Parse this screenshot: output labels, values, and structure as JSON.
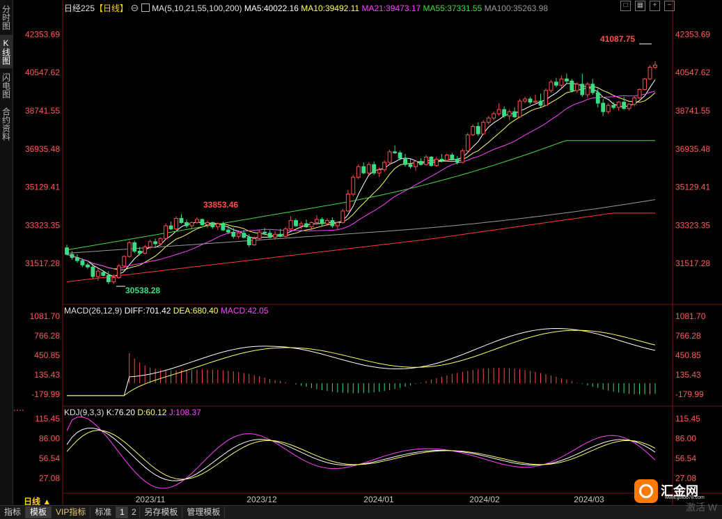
{
  "side_tabs": [
    {
      "label": "分时图",
      "active": false
    },
    {
      "label": "K线图",
      "active": true
    },
    {
      "label": "闪电图",
      "active": false
    },
    {
      "label": "合约资料",
      "active": false
    }
  ],
  "legend_main": {
    "symbol": "日经225",
    "period": "【日线】",
    "ma_params": "MA(5,10,21,55,100,200)",
    "ma5": "MA5:40022.16",
    "ma10": "MA10:39492.11",
    "ma21": "MA21:39473.17",
    "ma55": "MA55:37331.55",
    "ma100": "MA100:35263.98"
  },
  "legend_macd": {
    "name": "MACD(26,12,9)",
    "diff": "DIFF:701.42",
    "dea": "DEA:680.40",
    "macd": "MACD:42.05"
  },
  "legend_kdj": {
    "name": "KDJ(9,3,3)",
    "k": "K:76.20",
    "d": "D:60.12",
    "j": "J:108.37"
  },
  "price_axis": [
    "42353.69",
    "40547.62",
    "38741.55",
    "36935.48",
    "35129.41",
    "33323.35",
    "31517.28"
  ],
  "macd_axis": [
    "1081.70",
    "766.28",
    "450.85",
    "135.43",
    "-179.99"
  ],
  "kdj_axis": [
    "115.45",
    "86.00",
    "56.54",
    "27.08"
  ],
  "x_axis": [
    "2023/11",
    "2023/12",
    "2024/01",
    "2024/02",
    "2024/03"
  ],
  "annotations": {
    "high_label": "41087.75",
    "mid_high_label": "33853.46",
    "low_label": "30538.28"
  },
  "bottom_tabs": [
    "指标",
    "模板",
    "VIP指标",
    "标准",
    "1",
    "2",
    "另存模板",
    "管理模板"
  ],
  "period_label": "日线 ▲",
  "watermark": {
    "name": "汇金网",
    "url": "www.gold678.com"
  },
  "activate_text": "激活 W",
  "colors": {
    "up": "#ff4f4f",
    "down": "#3ddc84",
    "ma5": "#ffffff",
    "ma10": "#ffff66",
    "ma21": "#ff44ff",
    "ma55": "#44dd44",
    "ma100": "#9a9a9a",
    "ma200": "#ff3b3b",
    "axis_text": "#ff5b5b"
  },
  "chart_data": {
    "type": "candlestick",
    "price_range": [
      29711,
      43257
    ],
    "candles": [
      {
        "o": 32258,
        "h": 32400,
        "l": 31900,
        "c": 31950
      },
      {
        "o": 31950,
        "h": 32100,
        "l": 31700,
        "c": 31800
      },
      {
        "o": 31800,
        "h": 31950,
        "l": 31550,
        "c": 31650
      },
      {
        "o": 31650,
        "h": 31750,
        "l": 31350,
        "c": 31450
      },
      {
        "o": 31450,
        "h": 31550,
        "l": 31250,
        "c": 31350
      },
      {
        "o": 31350,
        "h": 31500,
        "l": 30800,
        "c": 30900
      },
      {
        "o": 30900,
        "h": 31300,
        "l": 30700,
        "c": 31150
      },
      {
        "o": 31100,
        "h": 31200,
        "l": 30900,
        "c": 30950
      },
      {
        "o": 30950,
        "h": 31150,
        "l": 30538.28,
        "c": 30650
      },
      {
        "o": 30650,
        "h": 31000,
        "l": 30550,
        "c": 30850
      },
      {
        "o": 30850,
        "h": 31500,
        "l": 30800,
        "c": 31400
      },
      {
        "o": 31400,
        "h": 31900,
        "l": 31350,
        "c": 31850
      },
      {
        "o": 31850,
        "h": 32600,
        "l": 31800,
        "c": 32500
      },
      {
        "o": 32500,
        "h": 32600,
        "l": 32000,
        "c": 32100
      },
      {
        "o": 32100,
        "h": 32300,
        "l": 31900,
        "c": 32000
      },
      {
        "o": 32000,
        "h": 32400,
        "l": 31950,
        "c": 32300
      },
      {
        "o": 32300,
        "h": 32650,
        "l": 32200,
        "c": 32550
      },
      {
        "o": 32550,
        "h": 32700,
        "l": 32300,
        "c": 32450
      },
      {
        "o": 32450,
        "h": 32750,
        "l": 32350,
        "c": 32700
      },
      {
        "o": 32700,
        "h": 33400,
        "l": 32650,
        "c": 33300
      },
      {
        "o": 33300,
        "h": 33500,
        "l": 33100,
        "c": 33150
      },
      {
        "o": 33150,
        "h": 33750,
        "l": 33100,
        "c": 33650
      },
      {
        "o": 33650,
        "h": 33853.46,
        "l": 33400,
        "c": 33450
      },
      {
        "o": 33450,
        "h": 33600,
        "l": 33200,
        "c": 33300
      },
      {
        "o": 33300,
        "h": 33500,
        "l": 33150,
        "c": 33450
      },
      {
        "o": 33450,
        "h": 33700,
        "l": 33400,
        "c": 33600
      },
      {
        "o": 33600,
        "h": 33650,
        "l": 33300,
        "c": 33350
      },
      {
        "o": 33350,
        "h": 33550,
        "l": 33200,
        "c": 33450
      },
      {
        "o": 33450,
        "h": 33500,
        "l": 33150,
        "c": 33250
      },
      {
        "o": 33250,
        "h": 33450,
        "l": 33100,
        "c": 33400
      },
      {
        "o": 33400,
        "h": 33500,
        "l": 33050,
        "c": 33100
      },
      {
        "o": 33100,
        "h": 33300,
        "l": 32900,
        "c": 33000
      },
      {
        "o": 33000,
        "h": 33200,
        "l": 32700,
        "c": 32800
      },
      {
        "o": 32800,
        "h": 33050,
        "l": 32700,
        "c": 32950
      },
      {
        "o": 32950,
        "h": 33100,
        "l": 32700,
        "c": 32750
      },
      {
        "o": 32750,
        "h": 32900,
        "l": 32300,
        "c": 32400
      },
      {
        "o": 32400,
        "h": 32800,
        "l": 32350,
        "c": 32700
      },
      {
        "o": 32700,
        "h": 33100,
        "l": 32650,
        "c": 33000
      },
      {
        "o": 33000,
        "h": 33200,
        "l": 32850,
        "c": 32950
      },
      {
        "o": 32950,
        "h": 33100,
        "l": 32700,
        "c": 32750
      },
      {
        "o": 32750,
        "h": 33050,
        "l": 32650,
        "c": 32900
      },
      {
        "o": 32900,
        "h": 33150,
        "l": 32750,
        "c": 32800
      },
      {
        "o": 32800,
        "h": 33250,
        "l": 32750,
        "c": 33150
      },
      {
        "o": 33150,
        "h": 33750,
        "l": 33100,
        "c": 33550
      },
      {
        "o": 33550,
        "h": 33650,
        "l": 33250,
        "c": 33300
      },
      {
        "o": 33300,
        "h": 33500,
        "l": 33150,
        "c": 33400
      },
      {
        "o": 33400,
        "h": 33600,
        "l": 33200,
        "c": 33250
      },
      {
        "o": 33250,
        "h": 33500,
        "l": 33100,
        "c": 33450
      },
      {
        "o": 33450,
        "h": 33800,
        "l": 33350,
        "c": 33600
      },
      {
        "o": 33600,
        "h": 33700,
        "l": 33300,
        "c": 33400
      },
      {
        "o": 33400,
        "h": 33650,
        "l": 33300,
        "c": 33550
      },
      {
        "o": 33550,
        "h": 33700,
        "l": 33200,
        "c": 33300
      },
      {
        "o": 33300,
        "h": 33500,
        "l": 33100,
        "c": 33450
      },
      {
        "o": 33450,
        "h": 34100,
        "l": 33400,
        "c": 34000
      },
      {
        "o": 34000,
        "h": 35000,
        "l": 33950,
        "c": 34800
      },
      {
        "o": 34800,
        "h": 35700,
        "l": 34700,
        "c": 35600
      },
      {
        "o": 35600,
        "h": 36200,
        "l": 35500,
        "c": 36100
      },
      {
        "o": 36100,
        "h": 36300,
        "l": 35750,
        "c": 35800
      },
      {
        "o": 35800,
        "h": 36300,
        "l": 35700,
        "c": 36200
      },
      {
        "o": 36200,
        "h": 36350,
        "l": 35700,
        "c": 35800
      },
      {
        "o": 35800,
        "h": 36050,
        "l": 35600,
        "c": 35950
      },
      {
        "o": 35950,
        "h": 36400,
        "l": 35850,
        "c": 36300
      },
      {
        "o": 36300,
        "h": 36900,
        "l": 36250,
        "c": 36800
      },
      {
        "o": 36800,
        "h": 37100,
        "l": 36700,
        "c": 36750
      },
      {
        "o": 36750,
        "h": 36850,
        "l": 36400,
        "c": 36500
      },
      {
        "o": 36500,
        "h": 36700,
        "l": 36100,
        "c": 36200
      },
      {
        "o": 36200,
        "h": 36450,
        "l": 36000,
        "c": 36100
      },
      {
        "o": 36100,
        "h": 36400,
        "l": 35900,
        "c": 36350
      },
      {
        "o": 36350,
        "h": 36500,
        "l": 36150,
        "c": 36200
      },
      {
        "o": 36200,
        "h": 36650,
        "l": 36150,
        "c": 36550
      },
      {
        "o": 36550,
        "h": 36600,
        "l": 36100,
        "c": 36150
      },
      {
        "o": 36150,
        "h": 36550,
        "l": 36100,
        "c": 36450
      },
      {
        "o": 36450,
        "h": 36700,
        "l": 36300,
        "c": 36400
      },
      {
        "o": 36400,
        "h": 36700,
        "l": 36350,
        "c": 36650
      },
      {
        "o": 36650,
        "h": 36750,
        "l": 36400,
        "c": 36450
      },
      {
        "o": 36450,
        "h": 36600,
        "l": 36200,
        "c": 36300
      },
      {
        "o": 36300,
        "h": 36950,
        "l": 36250,
        "c": 36850
      },
      {
        "o": 36850,
        "h": 37700,
        "l": 36800,
        "c": 37600
      },
      {
        "o": 37600,
        "h": 38100,
        "l": 37550,
        "c": 38000
      },
      {
        "o": 38000,
        "h": 38200,
        "l": 37550,
        "c": 37650
      },
      {
        "o": 37650,
        "h": 38300,
        "l": 37600,
        "c": 38200
      },
      {
        "o": 38200,
        "h": 38500,
        "l": 38100,
        "c": 38400
      },
      {
        "o": 38400,
        "h": 38700,
        "l": 38300,
        "c": 38600
      },
      {
        "o": 38600,
        "h": 39100,
        "l": 38500,
        "c": 38800
      },
      {
        "o": 38800,
        "h": 38950,
        "l": 38400,
        "c": 38500
      },
      {
        "o": 38500,
        "h": 38800,
        "l": 38300,
        "c": 38700
      },
      {
        "o": 38700,
        "h": 38900,
        "l": 38400,
        "c": 38450
      },
      {
        "o": 38450,
        "h": 39300,
        "l": 38400,
        "c": 39200
      },
      {
        "o": 39200,
        "h": 39400,
        "l": 39100,
        "c": 39300
      },
      {
        "o": 39300,
        "h": 39400,
        "l": 39050,
        "c": 39150
      },
      {
        "o": 39150,
        "h": 39500,
        "l": 39100,
        "c": 39200
      },
      {
        "o": 39200,
        "h": 39550,
        "l": 38900,
        "c": 39000
      },
      {
        "o": 39000,
        "h": 39800,
        "l": 38950,
        "c": 39700
      },
      {
        "o": 39700,
        "h": 40200,
        "l": 39600,
        "c": 40100
      },
      {
        "o": 40100,
        "h": 40300,
        "l": 39850,
        "c": 39950
      },
      {
        "o": 39950,
        "h": 40400,
        "l": 39800,
        "c": 40250
      },
      {
        "o": 40250,
        "h": 40500,
        "l": 40000,
        "c": 40150
      },
      {
        "o": 40150,
        "h": 40250,
        "l": 39600,
        "c": 39700
      },
      {
        "o": 39700,
        "h": 40100,
        "l": 39600,
        "c": 40000
      },
      {
        "o": 40000,
        "h": 40500,
        "l": 39400,
        "c": 39500
      },
      {
        "o": 39500,
        "h": 40100,
        "l": 39350,
        "c": 40000
      },
      {
        "o": 40000,
        "h": 40250,
        "l": 39500,
        "c": 39600
      },
      {
        "o": 39600,
        "h": 39800,
        "l": 38900,
        "c": 39100
      },
      {
        "o": 39100,
        "h": 39300,
        "l": 38500,
        "c": 38700
      },
      {
        "o": 38700,
        "h": 39100,
        "l": 38600,
        "c": 39000
      },
      {
        "o": 39000,
        "h": 39150,
        "l": 38800,
        "c": 38900
      },
      {
        "o": 38900,
        "h": 39200,
        "l": 38750,
        "c": 39150
      },
      {
        "o": 39150,
        "h": 39400,
        "l": 38800,
        "c": 38850
      },
      {
        "o": 38850,
        "h": 39100,
        "l": 38750,
        "c": 39050
      },
      {
        "o": 39050,
        "h": 39450,
        "l": 38950,
        "c": 39350
      },
      {
        "o": 39350,
        "h": 39800,
        "l": 39300,
        "c": 39750
      },
      {
        "o": 39750,
        "h": 40300,
        "l": 39700,
        "c": 40250
      },
      {
        "o": 40250,
        "h": 40900,
        "l": 40200,
        "c": 40800
      },
      {
        "o": 40800,
        "h": 41087.75,
        "l": 40700,
        "c": 40900
      }
    ]
  }
}
